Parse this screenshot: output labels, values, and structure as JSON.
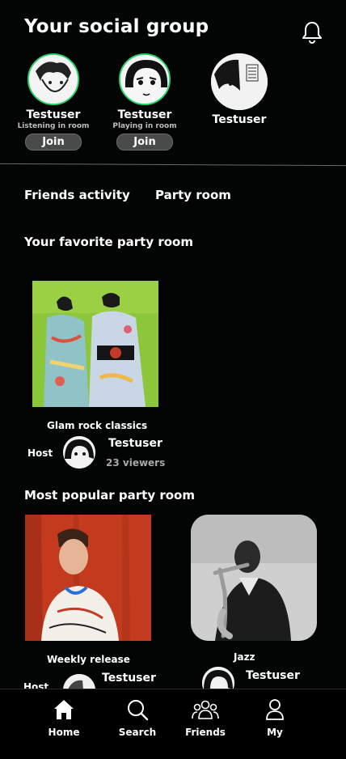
{
  "header": {
    "title": "Your social group",
    "bell_icon": "bell-icon"
  },
  "friends": [
    {
      "name": "Testuser",
      "status": "Listening in room",
      "join_label": "Join",
      "online": true
    },
    {
      "name": "Testuser",
      "status": "Playing in room",
      "join_label": "Join",
      "online": true
    },
    {
      "name": "Testuser",
      "status": "",
      "join_label": "",
      "online": false
    }
  ],
  "tabs": [
    "Friends activity",
    "Party room"
  ],
  "favorite": {
    "heading": "Your favorite party room",
    "room": {
      "title": "Glam rock classics",
      "host_label": "Host",
      "host_name": "Testuser",
      "viewers": "23 viewers"
    }
  },
  "popular": {
    "heading": "Most popular party room",
    "rooms": [
      {
        "title": "Weekly release",
        "host_label": "Host",
        "host_name": "Testuser"
      },
      {
        "title": "Jazz",
        "host_name": "Testuser"
      }
    ]
  },
  "nav": [
    {
      "label": "Home",
      "icon": "home-icon"
    },
    {
      "label": "Search",
      "icon": "search-icon"
    },
    {
      "label": "Friends",
      "icon": "friends-icon"
    },
    {
      "label": "My",
      "icon": "user-icon"
    }
  ],
  "colors": {
    "background": "#030504",
    "online_ring": "#2bd46a",
    "join_bg": "#4a4a4a"
  }
}
